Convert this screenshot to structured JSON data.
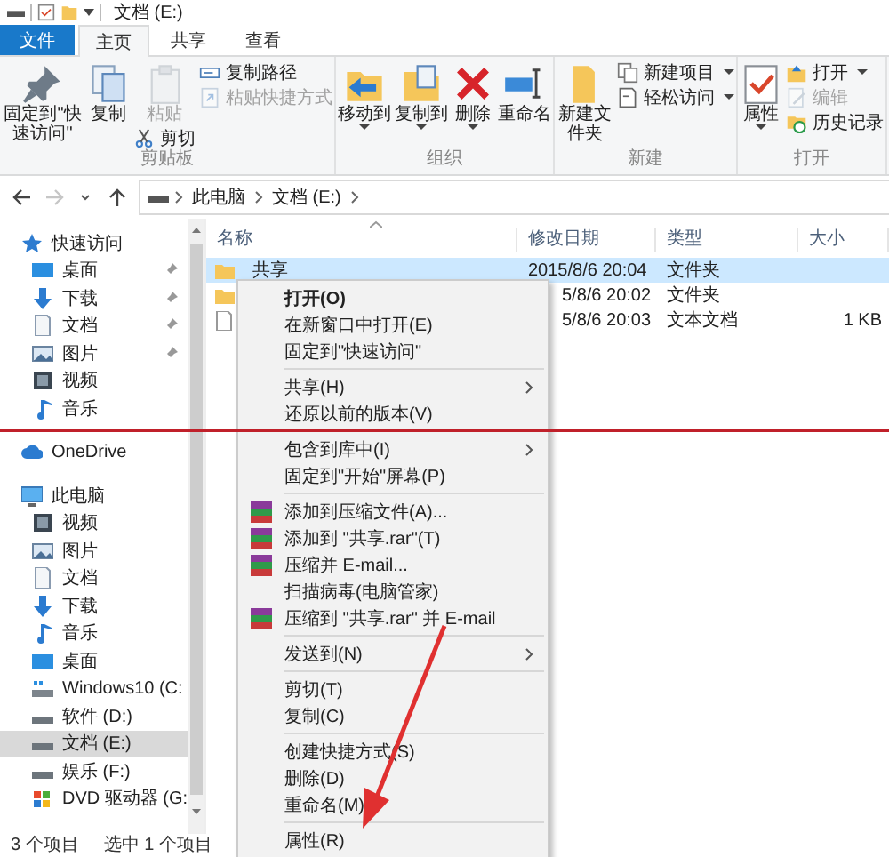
{
  "window": {
    "title": "文档 (E:)"
  },
  "tabs": [
    {
      "label": "文件",
      "kind": "file",
      "selected": false
    },
    {
      "label": "主页",
      "kind": "tab",
      "selected": true
    },
    {
      "label": "共享",
      "kind": "tab",
      "selected": false
    },
    {
      "label": "查看",
      "kind": "tab",
      "selected": false
    }
  ],
  "ribbon": {
    "groups": [
      {
        "label": "剪贴板",
        "columns": [
          [
            {
              "label": "固定到\"快速访问\"",
              "kind": "large",
              "dropdown": false,
              "disabled": false
            }
          ],
          [
            {
              "label": "复制",
              "kind": "large",
              "dropdown": false,
              "disabled": false
            }
          ],
          [
            {
              "label": "粘贴",
              "kind": "large",
              "dropdown": false,
              "disabled": true
            },
            {
              "label": "剪切",
              "kind": "small",
              "dropdown": false,
              "disabled": false
            }
          ],
          [
            {
              "label": "复制路径",
              "kind": "small",
              "dropdown": false,
              "disabled": false
            },
            {
              "label": "粘贴快捷方式",
              "kind": "small",
              "dropdown": false,
              "disabled": true
            }
          ]
        ]
      },
      {
        "label": "组织",
        "columns": [
          [
            {
              "label": "移动到",
              "kind": "large",
              "dropdown": true,
              "disabled": false
            }
          ],
          [
            {
              "label": "复制到",
              "kind": "large",
              "dropdown": true,
              "disabled": false
            }
          ],
          [
            {
              "label": "删除",
              "kind": "large",
              "dropdown": true,
              "disabled": false
            }
          ],
          [
            {
              "label": "重命名",
              "kind": "large",
              "dropdown": false,
              "disabled": false
            }
          ]
        ]
      },
      {
        "label": "新建",
        "columns": [
          [
            {
              "label": "新建文件夹",
              "kind": "large",
              "dropdown": false,
              "disabled": false
            }
          ],
          [
            {
              "label": "新建项目",
              "kind": "small",
              "dropdown": true,
              "disabled": false
            },
            {
              "label": "轻松访问",
              "kind": "small",
              "dropdown": true,
              "disabled": false
            }
          ]
        ]
      },
      {
        "label": "打开",
        "columns": [
          [
            {
              "label": "属性",
              "kind": "large",
              "dropdown": true,
              "disabled": false
            }
          ],
          [
            {
              "label": "打开",
              "kind": "small",
              "dropdown": true,
              "disabled": false
            },
            {
              "label": "编辑",
              "kind": "small",
              "dropdown": false,
              "disabled": true
            },
            {
              "label": "历史记录",
              "kind": "small",
              "dropdown": false,
              "disabled": false
            }
          ]
        ]
      }
    ]
  },
  "address": {
    "nav_buttons": [
      {
        "kind": "back",
        "disabled": false
      },
      {
        "kind": "forward",
        "disabled": true
      },
      {
        "kind": "recent",
        "disabled": false
      },
      {
        "kind": "up",
        "disabled": false
      }
    ],
    "crumbs": [
      "此电脑",
      "文档 (E:)"
    ]
  },
  "sidebar": {
    "items": [
      {
        "label": "快速访问",
        "kind": "star",
        "selected": false,
        "children": [
          {
            "label": "桌面",
            "kind": "desktop",
            "pinned": true,
            "selected": false
          },
          {
            "label": "下载",
            "kind": "download",
            "pinned": true,
            "selected": false
          },
          {
            "label": "文档",
            "kind": "document",
            "pinned": true,
            "selected": false
          },
          {
            "label": "图片",
            "kind": "picture",
            "pinned": true,
            "selected": false
          },
          {
            "label": "视频",
            "kind": "video",
            "pinned": false,
            "selected": false
          },
          {
            "label": "音乐",
            "kind": "music",
            "pinned": false,
            "selected": false
          }
        ]
      },
      {
        "label": "OneDrive",
        "kind": "cloud",
        "selected": false
      },
      {
        "label": "此电脑",
        "kind": "pc",
        "selected": false,
        "children": [
          {
            "label": "视频",
            "kind": "video",
            "selected": false
          },
          {
            "label": "图片",
            "kind": "picture",
            "selected": false
          },
          {
            "label": "文档",
            "kind": "document",
            "selected": false
          },
          {
            "label": "下载",
            "kind": "download",
            "selected": false
          },
          {
            "label": "音乐",
            "kind": "music",
            "selected": false
          },
          {
            "label": "桌面",
            "kind": "desktop",
            "selected": false
          },
          {
            "label": "Windows10 (C:",
            "kind": "system-drive",
            "selected": false
          },
          {
            "label": "软件 (D:)",
            "kind": "drive",
            "selected": false
          },
          {
            "label": "文档 (E:)",
            "kind": "drive",
            "selected": true
          },
          {
            "label": "娱乐 (F:)",
            "kind": "drive",
            "selected": false
          },
          {
            "label": "DVD 驱动器 (G:",
            "kind": "dvd",
            "selected": false
          }
        ]
      }
    ]
  },
  "file_list": {
    "columns": [
      "名称",
      "修改日期",
      "类型",
      "大小"
    ],
    "rows": [
      {
        "kind": "folder",
        "name": "共享",
        "modified": "2015/8/6 20:04",
        "type": "文件夹",
        "selected": true
      },
      {
        "kind": "folder",
        "modified": "5/8/6 20:02",
        "type": "文件夹",
        "selected": false
      },
      {
        "kind": "text",
        "modified": "5/8/6 20:03",
        "type": "文本文档",
        "size": "1 KB",
        "selected": false
      }
    ]
  },
  "context_menu": {
    "groups": [
      [
        {
          "label": "打开(O)",
          "default": true,
          "submenu": false,
          "has_icon": false
        },
        {
          "label": "在新窗口中打开(E)",
          "default": false,
          "submenu": false,
          "has_icon": false
        },
        {
          "label": "固定到\"快速访问\"",
          "default": false,
          "submenu": false,
          "has_icon": false
        }
      ],
      [
        {
          "label": "共享(H)",
          "default": false,
          "submenu": true,
          "has_icon": false
        },
        {
          "label": "还原以前的版本(V)",
          "default": false,
          "submenu": false,
          "has_icon": false
        }
      ],
      [
        {
          "label": "包含到库中(I)",
          "default": false,
          "submenu": true,
          "has_icon": false
        },
        {
          "label": "固定到\"开始\"屏幕(P)",
          "default": false,
          "submenu": false,
          "has_icon": false
        }
      ],
      [
        {
          "label": "添加到压缩文件(A)...",
          "default": false,
          "submenu": false,
          "has_icon": true
        },
        {
          "label": "添加到 \"共享.rar\"(T)",
          "default": false,
          "submenu": false,
          "has_icon": true
        },
        {
          "label": "压缩并 E-mail...",
          "default": false,
          "submenu": false,
          "has_icon": true
        },
        {
          "label": "扫描病毒(电脑管家)",
          "default": false,
          "submenu": false,
          "has_icon": false
        },
        {
          "label": "压缩到 \"共享.rar\" 并 E-mail",
          "default": false,
          "submenu": false,
          "has_icon": true
        }
      ],
      [
        {
          "label": "发送到(N)",
          "default": false,
          "submenu": true,
          "has_icon": false
        }
      ],
      [
        {
          "label": "剪切(T)",
          "default": false,
          "submenu": false,
          "has_icon": false
        },
        {
          "label": "复制(C)",
          "default": false,
          "submenu": false,
          "has_icon": false
        }
      ],
      [
        {
          "label": "创建快捷方式(S)",
          "default": false,
          "submenu": false,
          "has_icon": false
        },
        {
          "label": "删除(D)",
          "default": false,
          "submenu": false,
          "has_icon": false
        },
        {
          "label": "重命名(M)",
          "default": false,
          "submenu": false,
          "has_icon": false
        }
      ],
      [
        {
          "label": "属性(R)",
          "default": false,
          "submenu": false,
          "has_icon": false
        }
      ]
    ]
  },
  "status_bar": {
    "items": [
      "3 个项目",
      "选中 1 个项目"
    ]
  },
  "annotations": {
    "line": true,
    "arrow": true
  }
}
